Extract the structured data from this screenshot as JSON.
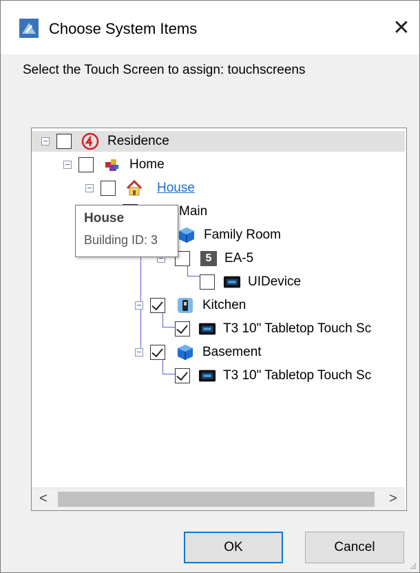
{
  "window": {
    "title": "Choose System Items",
    "close_glyph": "✕"
  },
  "prompt": "Select the Touch Screen to assign: touchscreens",
  "tree": {
    "residence": {
      "label": "Residence",
      "icon": "control4-logo-icon"
    },
    "home": {
      "label": "Home",
      "icon": "home-cubes-icon"
    },
    "house": {
      "label": "House",
      "icon": "house-icon"
    },
    "main": {
      "label": "Main",
      "icon": "floor-icon"
    },
    "family_room": {
      "label": "Family Room",
      "icon": "room-cube-icon"
    },
    "ea5": {
      "label": "EA-5",
      "badge": "5",
      "icon": "controller-icon"
    },
    "uidevice": {
      "label": "UIDevice",
      "icon": "ui-device-icon"
    },
    "kitchen": {
      "label": "Kitchen",
      "icon": "kitchen-room-icon"
    },
    "kitchen_t3": {
      "label": "T3 10\" Tabletop Touch Sc",
      "icon": "touchscreen-icon"
    },
    "basement": {
      "label": "Basement",
      "icon": "room-cube-icon"
    },
    "basement_t3": {
      "label": "T3 10\" Tabletop Touch Sc",
      "icon": "touchscreen-icon"
    }
  },
  "checked": {
    "kitchen": true,
    "kitchen_t3": true,
    "basement": true,
    "basement_t3": true
  },
  "tooltip": {
    "title": "House",
    "body": "Building ID: 3"
  },
  "scrollbar": {
    "left_arrow": "<",
    "right_arrow": ">"
  },
  "buttons": {
    "ok": "OK",
    "cancel": "Cancel"
  },
  "colors": {
    "accent": "#0078d7",
    "link": "#1a6fd1",
    "tree_lines": "#5a5ad6"
  }
}
